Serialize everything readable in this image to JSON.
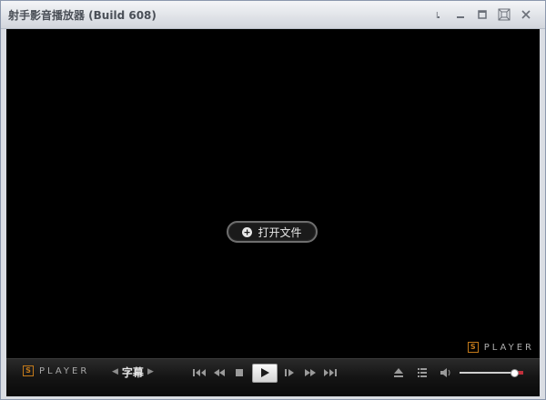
{
  "window": {
    "title": "射手影音播放器 (Build 608)",
    "controls": [
      "pin-icon",
      "minimize-icon",
      "restore-icon",
      "fullscreen-icon",
      "close-icon"
    ]
  },
  "video": {
    "open_file_label": "打开文件",
    "logo_text": "PLAYER",
    "logo_mark": "S"
  },
  "controlbar": {
    "logo_text": "PLAYER",
    "logo_mark": "S",
    "subtitle_label": "字幕",
    "transport": [
      "skip-back-icon",
      "rewind-icon",
      "stop-icon",
      "play-icon",
      "step-forward-icon",
      "fast-forward-icon",
      "skip-forward-icon"
    ],
    "right": [
      "eject-icon",
      "playlist-icon",
      "volume-icon"
    ],
    "volume_level": 0.86
  },
  "colors": {
    "accent_logo": "#c47a1a",
    "volume_end": "#c0303b"
  }
}
